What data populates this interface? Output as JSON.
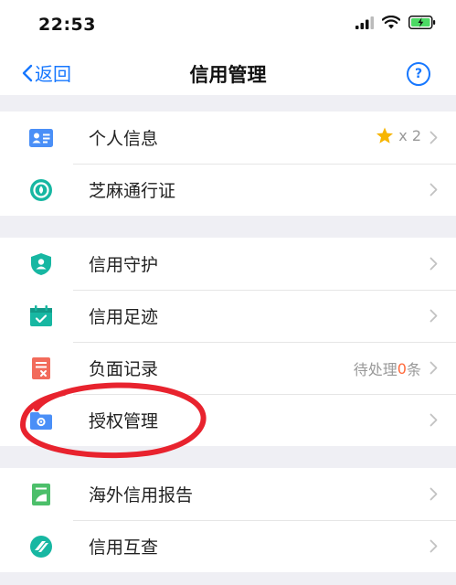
{
  "status_bar": {
    "time": "22:53"
  },
  "nav": {
    "back_label": "返回",
    "title": "信用管理",
    "help_symbol": "?"
  },
  "groups": [
    {
      "items": [
        {
          "label": "个人信息",
          "icon": "id-card-icon",
          "badge_star_count": "x 2"
        },
        {
          "label": "芝麻通行证",
          "icon": "sesame-icon"
        }
      ]
    },
    {
      "items": [
        {
          "label": "信用守护",
          "icon": "shield-user-icon"
        },
        {
          "label": "信用足迹",
          "icon": "calendar-check-icon"
        },
        {
          "label": "负面记录",
          "icon": "document-x-icon",
          "pending_prefix": "待处理",
          "pending_count": "0",
          "pending_suffix": "条"
        },
        {
          "label": "授权管理",
          "icon": "folder-gear-icon"
        }
      ]
    },
    {
      "items": [
        {
          "label": "海外信用报告",
          "icon": "report-icon"
        },
        {
          "label": "信用互查",
          "icon": "mutual-check-icon"
        }
      ]
    }
  ],
  "colors": {
    "accent": "#1677ff",
    "annotation": "#e8232e",
    "pending_count": "#ff6a3c"
  }
}
